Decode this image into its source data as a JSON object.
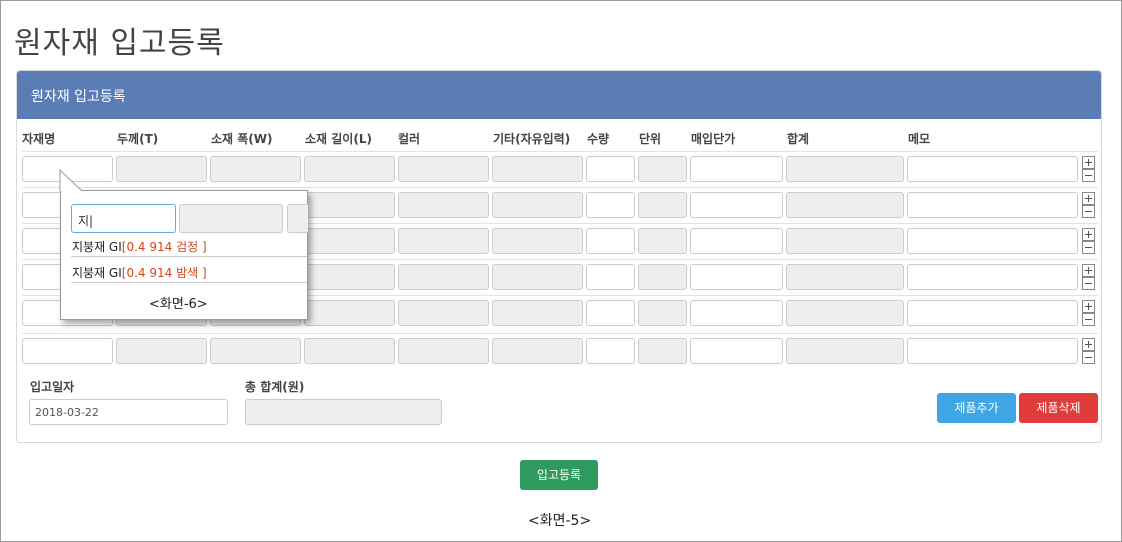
{
  "page_title": "원자재 입고등록",
  "panel_title": "원자재 입고등록",
  "columns": [
    "자재명",
    "두께(T)",
    "소재 폭(W)",
    "소재 길이(L)",
    "컬러",
    "기타(자유입력)",
    "수량",
    "단위",
    "매입단가",
    "합계",
    "메모"
  ],
  "footer": {
    "date_label": "입고일자",
    "date_value": "2018-03-22",
    "total_label": "총 합계(원)",
    "total_value": ""
  },
  "buttons": {
    "add_product": "제품추가",
    "delete_product": "제품삭제",
    "register": "입고등록"
  },
  "captions": {
    "screen5": "<화면-5>",
    "screen6": "<화면-6>"
  },
  "popup": {
    "search_value": "지|",
    "suggestions": [
      {
        "name": "지붕재 GI",
        "spec": "[0.4 914 검정 ]"
      },
      {
        "name": "지붕재 GI",
        "spec": "[0.4 914 밤색 ]"
      }
    ]
  },
  "colors": {
    "header": "#5b7db6",
    "add_button": "#3fa6e6",
    "delete_button": "#e03c3c",
    "register_button": "#2e9a5e",
    "highlight": "#d9441a"
  }
}
